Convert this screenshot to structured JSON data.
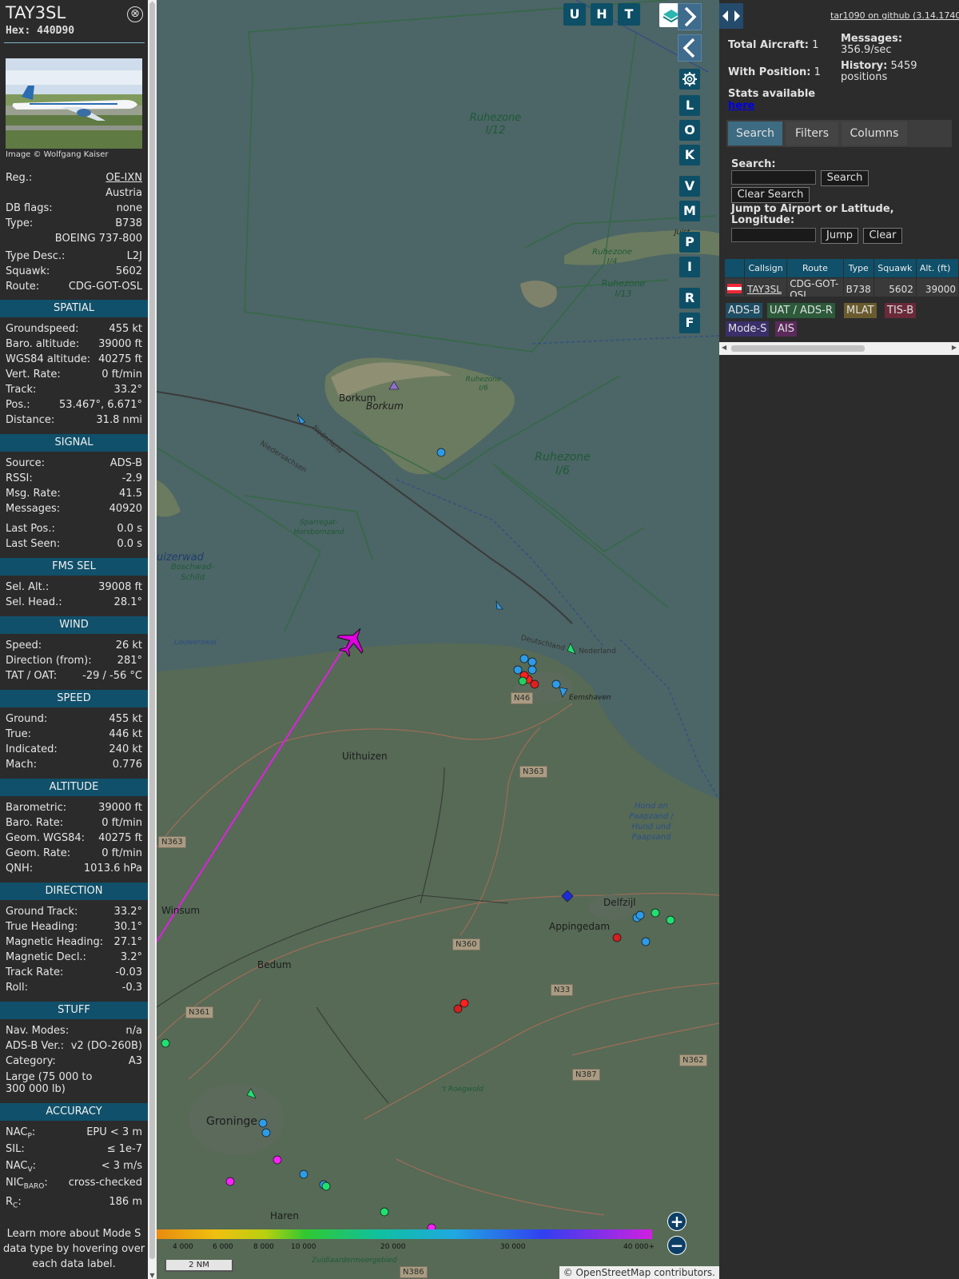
{
  "aircraft": {
    "callsign": "TAY3SL",
    "hex_label": "Hex:",
    "hex": "440D90",
    "image_credit": "Image © Wolfgang Kaiser",
    "close_glyph": "⊗"
  },
  "details": [
    {
      "label": "Reg.:",
      "value": "OE-IXN",
      "link": true
    },
    {
      "label": "",
      "value": "Austria"
    },
    {
      "label": "DB flags:",
      "value": "none"
    },
    {
      "label": "Type:",
      "value": "B738"
    },
    {
      "label": "",
      "value": "BOEING 737-800"
    },
    {
      "label": "Type Desc.:",
      "value": "L2J"
    },
    {
      "label": "Squawk:",
      "value": "5602"
    },
    {
      "label": "Route:",
      "value": "CDG-GOT-OSL"
    }
  ],
  "spatial": {
    "heading": "SPATIAL",
    "rows": [
      {
        "label": "Groundspeed:",
        "value": "455 kt"
      },
      {
        "label": "Baro. altitude:",
        "value": "39000 ft"
      },
      {
        "label": "WGS84 altitude:",
        "value": "40275 ft"
      },
      {
        "label": "Vert. Rate:",
        "value": "0 ft/min"
      },
      {
        "label": "Track:",
        "value": "33.2°"
      },
      {
        "label": "Pos.:",
        "value": "53.467°, 6.671°"
      },
      {
        "label": "Distance:",
        "value": "31.8 nmi"
      }
    ]
  },
  "signal": {
    "heading": "SIGNAL",
    "rows": [
      {
        "label": "Source:",
        "value": "ADS-B"
      },
      {
        "label": "RSSI:",
        "value": "-2.9"
      },
      {
        "label": "Msg. Rate:",
        "value": "41.5"
      },
      {
        "label": "Messages:",
        "value": "40920"
      },
      {
        "label": "Last Pos.:",
        "value": "0.0 s"
      },
      {
        "label": "Last Seen:",
        "value": "0.0 s"
      }
    ]
  },
  "fms": {
    "heading": "FMS SEL",
    "rows": [
      {
        "label": "Sel. Alt.:",
        "value": "39008 ft"
      },
      {
        "label": "Sel. Head.:",
        "value": "28.1°"
      }
    ]
  },
  "wind": {
    "heading": "WIND",
    "rows": [
      {
        "label": "Speed:",
        "value": "26 kt"
      },
      {
        "label": "Direction (from):",
        "value": "281°"
      },
      {
        "label": "TAT / OAT:",
        "value": "-29 / -56 °C"
      }
    ]
  },
  "speed": {
    "heading": "SPEED",
    "rows": [
      {
        "label": "Ground:",
        "value": "455 kt"
      },
      {
        "label": "True:",
        "value": "446 kt"
      },
      {
        "label": "Indicated:",
        "value": "240 kt"
      },
      {
        "label": "Mach:",
        "value": "0.776"
      }
    ]
  },
  "altitude": {
    "heading": "ALTITUDE",
    "rows": [
      {
        "label": "Barometric:",
        "value": "39000 ft"
      },
      {
        "label": "Baro. Rate:",
        "value": "0 ft/min"
      },
      {
        "label": "Geom. WGS84:",
        "value": "40275 ft"
      },
      {
        "label": "Geom. Rate:",
        "value": "0 ft/min"
      },
      {
        "label": "QNH:",
        "value": "1013.6 hPa"
      }
    ]
  },
  "direction": {
    "heading": "DIRECTION",
    "rows": [
      {
        "label": "Ground Track:",
        "value": "33.2°"
      },
      {
        "label": "True Heading:",
        "value": "30.1°"
      },
      {
        "label": "Magnetic Heading:",
        "value": "27.1°"
      },
      {
        "label": "Magnetic Decl.:",
        "value": "3.2°"
      },
      {
        "label": "Track Rate:",
        "value": "-0.03"
      },
      {
        "label": "Roll:",
        "value": "-0.3"
      }
    ]
  },
  "stuff": {
    "heading": "STUFF",
    "rows": [
      {
        "label": "Nav. Modes:",
        "value": "n/a"
      },
      {
        "label": "ADS-B Ver.:",
        "value": "v2 (DO-260B)"
      },
      {
        "label": "Category:",
        "value": "A3"
      }
    ],
    "category_desc": "Large (75 000 to 300 000 lb)"
  },
  "accuracy": {
    "heading": "ACCURACY",
    "nacp_label": "NAC",
    "nacp_sub": "P",
    "nacp_value": "EPU < 3 m",
    "sil_label": "SIL:",
    "sil_value": "≤ 1e-7",
    "nacv_label": "NAC",
    "nacv_sub": "V",
    "nacv_value": "< 3 m/s",
    "nic_label": "NIC",
    "nic_sub": "BARO",
    "nic_value": "cross-checked",
    "rc_label": "R",
    "rc_sub": "C",
    "rc_value": "186 m",
    "colon": ":"
  },
  "footer_note": "Learn more about Mode S data type by hovering over each data label.",
  "map": {
    "places": [
      "Borkum",
      "Borkum",
      "Uithuizen",
      "Delfzijl",
      "Appingedam",
      "Bedum",
      "Winsum",
      "Groninge",
      "Haren",
      "Eemshaven",
      "Juist"
    ],
    "zones": [
      {
        "name": "Ruhezone I/12"
      },
      {
        "name": "Ruhezone I/6"
      },
      {
        "name": "Ruhezone I/6"
      },
      {
        "name": "Ruhezone I/4"
      },
      {
        "name": "Ruhezone I/13"
      },
      {
        "name": "Hond en Paapzand / Hund und Paapsand"
      }
    ],
    "roads": [
      "N46",
      "N363",
      "N363",
      "N360",
      "N33",
      "N361",
      "N387",
      "N362",
      "N386"
    ],
    "water_labels": [
      "Nederland",
      "Niedersachsen",
      "Deutschland",
      "Nederland",
      "Louwerswal",
      "uizerwad",
      "Boschwad-Schild",
      "Sparregat-Horsbornzand",
      "Zuidlaardermeergebied",
      "'t Roegwold"
    ],
    "top_buttons": [
      "U",
      "H",
      "T"
    ],
    "side_buttons": [
      "L",
      "O",
      "K",
      "V",
      "M",
      "P",
      "I",
      "R",
      "F"
    ],
    "altitude_legend": [
      "4 000",
      "6 000",
      "8 000",
      "10 000",
      "20 000",
      "30 000",
      "40 000+"
    ],
    "scale_label": "2 NM",
    "attribution_prefix": "©",
    "attribution_link": "OpenStreetMap",
    "attribution_suffix": "contributors.",
    "zoom_in": "+",
    "zoom_out": "−",
    "colors": {
      "track": "#e020e0",
      "plane": "#e000e0"
    }
  },
  "right": {
    "version_link": "tar1090 on github (3.14.1740)",
    "total_label": "Total Aircraft:",
    "total_value": "1",
    "position_label": "With Position:",
    "position_value": "1",
    "messages_label": "Messages:",
    "messages_value": "356.9/sec",
    "history_label": "History:",
    "history_value": "5459 positions",
    "stats_label": "Stats available",
    "stats_link": "here",
    "tabs": [
      "Search",
      "Filters",
      "Columns"
    ],
    "search_label": "Search:",
    "search_button": "Search",
    "clear_search_button": "Clear Search",
    "jump_label": "Jump to Airport or Latitude, Longitude:",
    "jump_button": "Jump",
    "clear_button": "Clear",
    "table_headers": [
      "",
      "Callsign",
      "Route",
      "Type",
      "Squawk",
      "Alt. (ft)"
    ],
    "table_row": {
      "callsign": "TAY3SL",
      "route": "CDG-GOT-OSL",
      "type": "B738",
      "squawk": "5602",
      "alt": "39000"
    },
    "badges": [
      {
        "label": "ADS-B",
        "bg": "#1f4d63",
        "fg": "#e0e0e0"
      },
      {
        "label": "UAT / ADS-R",
        "bg": "#2c5a3a",
        "fg": "#e0e0e0"
      },
      {
        "label": "MLAT",
        "bg": "#6a5b2e",
        "fg": "#e0e0e0"
      },
      {
        "label": "TIS-B",
        "bg": "#6a2a3a",
        "fg": "#e0e0e0"
      },
      {
        "label": "Mode-S",
        "bg": "#3a2f6a",
        "fg": "#e0e0e0"
      },
      {
        "label": "AIS",
        "bg": "#5a2a5a",
        "fg": "#e0e0e0"
      }
    ]
  }
}
